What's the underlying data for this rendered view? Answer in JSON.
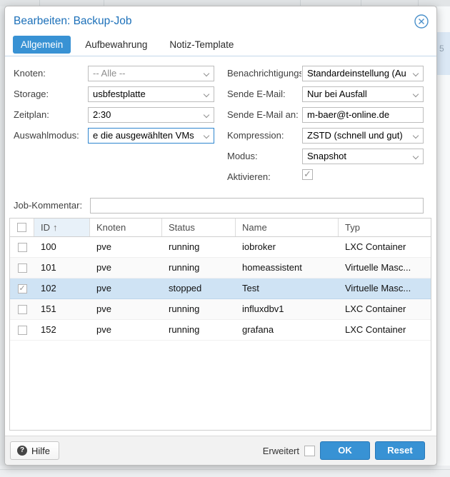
{
  "backdrop": {
    "row_fragment": "5"
  },
  "colors": {
    "accent_blue": "#3892d4",
    "title_blue": "#1c70b9",
    "selected_row": "#cfe3f4",
    "sorted_header": "#e8f1f9"
  },
  "dialog": {
    "title": "Bearbeiten: Backup-Job",
    "tabs": [
      {
        "label": "Allgemein",
        "active": true
      },
      {
        "label": "Aufbewahrung",
        "active": false
      },
      {
        "label": "Notiz-Template",
        "active": false
      }
    ],
    "form": {
      "left": [
        {
          "label": "Knoten:",
          "value": "-- Alle --",
          "type": "select",
          "disabled": true
        },
        {
          "label": "Storage:",
          "value": "usbfestplatte",
          "type": "select"
        },
        {
          "label": "Zeitplan:",
          "value": "2:30",
          "type": "combo"
        },
        {
          "label": "Auswahlmodus:",
          "value": "e die ausgewählten VMs",
          "type": "select",
          "focused": true
        }
      ],
      "right": [
        {
          "label": "Benachrichtigungs",
          "value": "Standardeinstellung (Au",
          "type": "select"
        },
        {
          "label": "Sende E-Mail:",
          "value": "Nur bei Ausfall",
          "type": "select"
        },
        {
          "label": "Sende E-Mail an:",
          "value": "m-baer@t-online.de",
          "type": "text"
        },
        {
          "label": "Kompression:",
          "value": "ZSTD (schnell und gut)",
          "type": "select"
        },
        {
          "label": "Modus:",
          "value": "Snapshot",
          "type": "select"
        },
        {
          "label": "Aktivieren:",
          "type": "checkbox",
          "checked": true
        }
      ],
      "comment": {
        "label": "Job-Kommentar:",
        "value": "",
        "placeholder": ""
      }
    },
    "table": {
      "columns": [
        "ID",
        "Knoten",
        "Status",
        "Name",
        "Typ"
      ],
      "sort": {
        "column": "ID",
        "direction": "asc",
        "arrow": "↑"
      },
      "rows": [
        {
          "checked": false,
          "selected": false,
          "id": "100",
          "knoten": "pve",
          "status": "running",
          "name": "iobroker",
          "typ": "LXC Container"
        },
        {
          "checked": false,
          "selected": false,
          "id": "101",
          "knoten": "pve",
          "status": "running",
          "name": "homeassistent",
          "typ": "Virtuelle Masc..."
        },
        {
          "checked": true,
          "selected": true,
          "id": "102",
          "knoten": "pve",
          "status": "stopped",
          "name": "Test",
          "typ": "Virtuelle Masc..."
        },
        {
          "checked": false,
          "selected": false,
          "id": "151",
          "knoten": "pve",
          "status": "running",
          "name": "influxdbv1",
          "typ": "LXC Container"
        },
        {
          "checked": false,
          "selected": false,
          "id": "152",
          "knoten": "pve",
          "status": "running",
          "name": "grafana",
          "typ": "LXC Container"
        }
      ]
    },
    "footer": {
      "help_label": "Hilfe",
      "advanced_label": "Erweitert",
      "advanced_checked": false,
      "ok_label": "OK",
      "reset_label": "Reset"
    }
  }
}
